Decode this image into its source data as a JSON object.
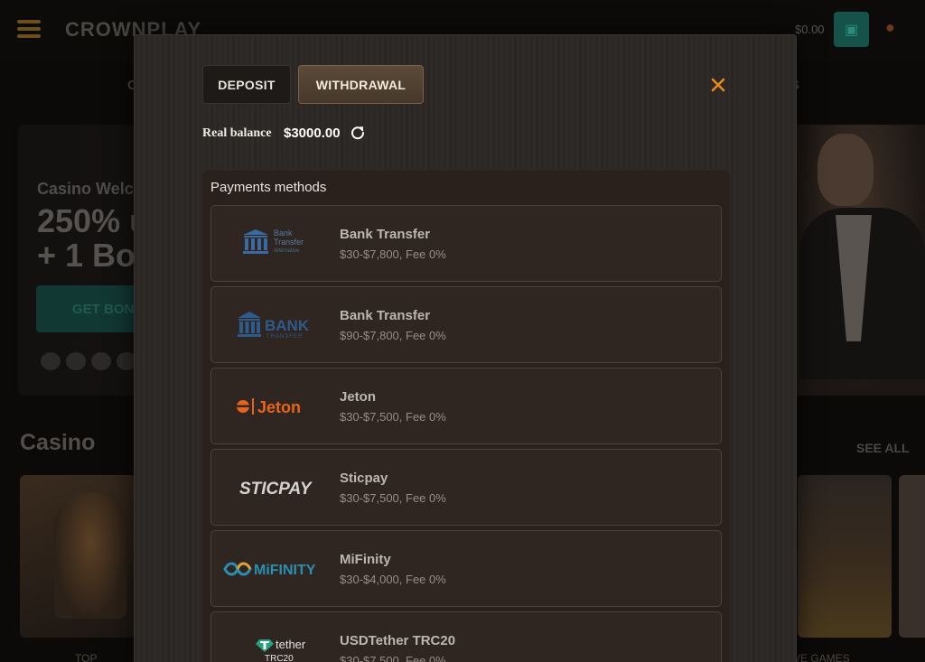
{
  "background": {
    "logo": "CROWNPLAY",
    "balance": "$0.00",
    "nav_left": "C",
    "nav_right": "S",
    "banner_subtitle": "Casino Welc",
    "banner_line1": "250% u",
    "banner_line2": "+ 1 Bo",
    "get_bonus": "GET BON",
    "section_title": "Casino",
    "see_all": "SEE ALL",
    "card_left_label": "TOP",
    "card_right_label": "VE GAMES"
  },
  "modal": {
    "tabs": {
      "deposit": "DEPOSIT",
      "withdrawal": "WITHDRAWAL"
    },
    "active_tab": "withdrawal",
    "balance_label": "Real balance",
    "balance_value": "$3000.00",
    "methods_title": "Payments methods",
    "methods": [
      {
        "logo_text": "Bank Transfer Alternative",
        "logo_icon": "bank-icon",
        "name": "Bank Transfer",
        "limits": "$30-$7,800, Fee 0%"
      },
      {
        "logo_text": "BANK TRANSFER",
        "logo_icon": "bank-icon",
        "name": "Bank Transfer",
        "limits": "$90-$7,800, Fee 0%"
      },
      {
        "logo_text": "Jeton",
        "logo_icon": "jeton-icon",
        "name": "Jeton",
        "limits": "$30-$7,500, Fee 0%"
      },
      {
        "logo_text": "STICPAY",
        "logo_icon": "sticpay-logo",
        "name": "Sticpay",
        "limits": "$30-$7,500, Fee 0%"
      },
      {
        "logo_text": "MiFINITY",
        "logo_icon": "infinity-icon",
        "name": "MiFinity",
        "limits": "$30-$4,000, Fee 0%"
      },
      {
        "logo_text": "tether TRC20",
        "logo_icon": "tether-icon",
        "name": "USDTether TRC20",
        "limits": "$30-$7,500, Fee 0%"
      }
    ]
  },
  "colors": {
    "accent_close": "#e8891e",
    "jeton_orange": "#e8641c",
    "bank_blue": "#2e5a8c",
    "mifinity_teal": "#2a8fb0"
  }
}
